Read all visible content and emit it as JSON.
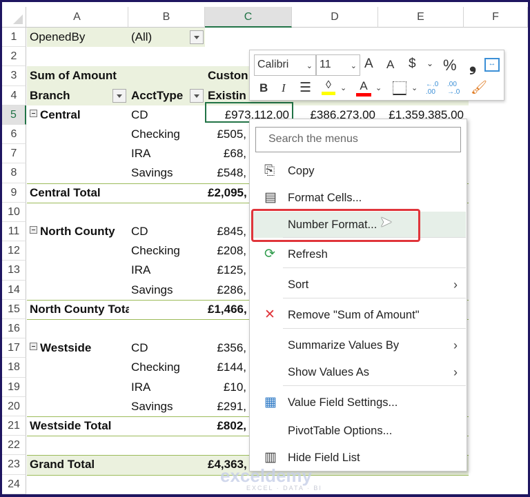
{
  "columns": [
    "A",
    "B",
    "C",
    "D",
    "E",
    "F"
  ],
  "selected_column": "C",
  "selected_row": 5,
  "rows": [
    {
      "n": 1,
      "a": "OpenedBy",
      "b": "(All)",
      "filter_b": true
    },
    {
      "n": 2
    },
    {
      "n": 3,
      "a": "Sum of Amount",
      "c": "Custon",
      "bold": true
    },
    {
      "n": 4,
      "a": "Branch",
      "b": "AcctType",
      "c": "Existin",
      "bold": true,
      "filter_a": true,
      "filter_b": true
    },
    {
      "n": 5,
      "a": "Central",
      "b": "CD",
      "c": "£973,112.00",
      "d": "£386,273.00",
      "e": "£1,359,385.00",
      "collapse": true
    },
    {
      "n": 6,
      "b": "Checking",
      "c": "£505,"
    },
    {
      "n": 7,
      "b": "IRA",
      "c": "£68,"
    },
    {
      "n": 8,
      "b": "Savings",
      "c": "£548,"
    },
    {
      "n": 9,
      "a": "Central Total",
      "c": "£2,095,",
      "total": true
    },
    {
      "n": 10
    },
    {
      "n": 11,
      "a": "North County",
      "b": "CD",
      "c": "£845,",
      "collapse": true
    },
    {
      "n": 12,
      "b": "Checking",
      "c": "£208,"
    },
    {
      "n": 13,
      "b": "IRA",
      "c": "£125,"
    },
    {
      "n": 14,
      "b": "Savings",
      "c": "£286,"
    },
    {
      "n": 15,
      "a": "North County Total",
      "c": "£1,466,",
      "total": true
    },
    {
      "n": 16
    },
    {
      "n": 17,
      "a": "Westside",
      "b": "CD",
      "c": "£356,",
      "collapse": true
    },
    {
      "n": 18,
      "b": "Checking",
      "c": "£144,"
    },
    {
      "n": 19,
      "b": "IRA",
      "c": "£10,"
    },
    {
      "n": 20,
      "b": "Savings",
      "c": "£291,"
    },
    {
      "n": 21,
      "a": "Westside Total",
      "c": "£802,",
      "total": true
    },
    {
      "n": 22
    },
    {
      "n": 23,
      "a": "Grand Total",
      "c": "£4,363,",
      "total": true,
      "grand": true
    },
    {
      "n": 24
    }
  ],
  "toolbar": {
    "font": "Calibri",
    "size": "11",
    "bold": "B",
    "italic": "I",
    "increase_font": "A",
    "decrease_font": "A",
    "currency": "$",
    "percent": "%",
    "comma": "❟",
    "font_color_letter": "A",
    "fill_color": "#ffff00",
    "font_color": "#ff0000",
    "dec_increase": "←.0 .00",
    "dec_decrease": ".00 →.0"
  },
  "menu": {
    "search_placeholder": "Search the menus",
    "items": [
      {
        "label": "Copy",
        "icon": "copy-icon"
      },
      {
        "label": "Format Cells...",
        "icon": "format-cells-icon"
      },
      {
        "label": "Number Format...",
        "highlighted": true
      },
      {
        "label": "Refresh",
        "icon": "refresh-icon"
      },
      {
        "label": "Sort",
        "submenu": true
      },
      {
        "label": "Remove \"Sum of Amount\"",
        "icon": "remove-x-icon"
      },
      {
        "label": "Summarize Values By",
        "submenu": true
      },
      {
        "label": "Show Values As",
        "submenu": true
      },
      {
        "label": "Value Field Settings...",
        "icon": "value-field-settings-icon"
      },
      {
        "label": "PivotTable Options..."
      },
      {
        "label": "Hide Field List",
        "icon": "field-list-icon"
      }
    ]
  },
  "watermark": {
    "name": "exceldemy",
    "tagline": "EXCEL · DATA · BI"
  },
  "colors": {
    "accent": "#217346",
    "pivot_band": "#ebf1de",
    "highlight_box": "#e0353b"
  }
}
